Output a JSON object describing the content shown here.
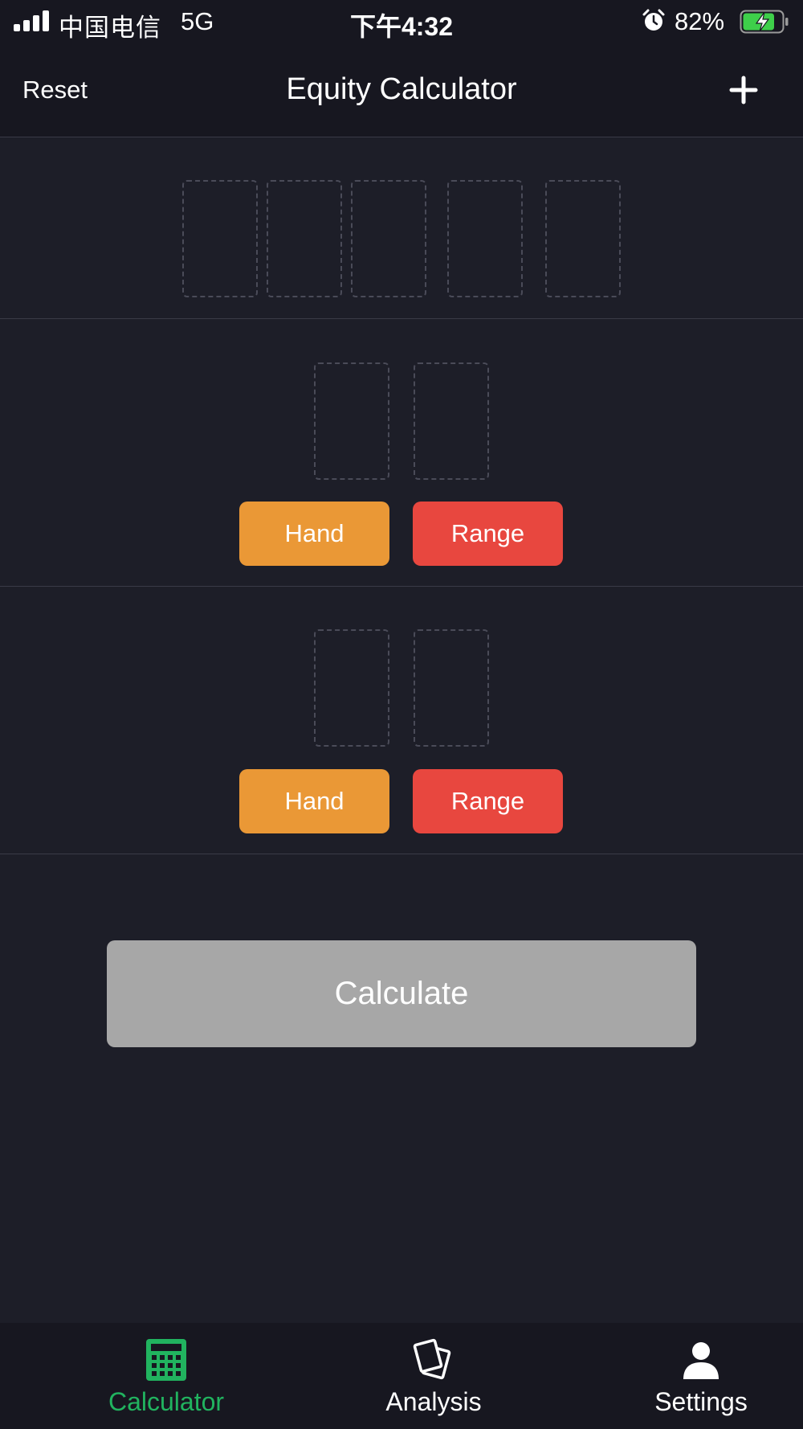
{
  "status_bar": {
    "carrier": "中国电信",
    "network": "5G",
    "time": "下午4:32",
    "battery_percent": "82%",
    "battery_level": 0.82,
    "charging": true
  },
  "nav": {
    "reset_label": "Reset",
    "title": "Equity Calculator",
    "add_icon": "plus-icon"
  },
  "board": {
    "card_slots": 5
  },
  "players": [
    {
      "hand_label": "Hand",
      "range_label": "Range",
      "card_slots": 2
    },
    {
      "hand_label": "Hand",
      "range_label": "Range",
      "card_slots": 2
    }
  ],
  "calculate_label": "Calculate",
  "tabs": [
    {
      "label": "Calculator",
      "icon": "calculator-icon",
      "active": true
    },
    {
      "label": "Analysis",
      "icon": "cards-icon",
      "active": false
    },
    {
      "label": "Settings",
      "icon": "person-icon",
      "active": false
    }
  ],
  "colors": {
    "background": "#1d1e28",
    "bar_background": "#171720",
    "hand_button": "#ea9836",
    "range_button": "#e8473f",
    "calculate_button": "#a7a7a7",
    "active_tab": "#21b35f",
    "battery_charging": "#3ecf4a"
  }
}
